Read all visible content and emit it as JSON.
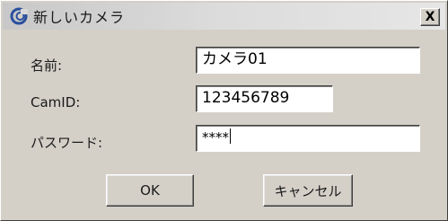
{
  "window": {
    "title": "新しいカメラ",
    "close_label": "X"
  },
  "form": {
    "name": {
      "label": "名前:",
      "value": "カメラ01"
    },
    "camid": {
      "label": "CamID:",
      "value": "123456789"
    },
    "password": {
      "label": "パスワード:",
      "value": "****"
    }
  },
  "buttons": {
    "ok_label": "OK",
    "cancel_label": "キャンセル"
  },
  "icons": {
    "title_icon": "app-camera-icon"
  },
  "colors": {
    "face": "#d4d0c8",
    "field_bg": "#ffffff"
  }
}
